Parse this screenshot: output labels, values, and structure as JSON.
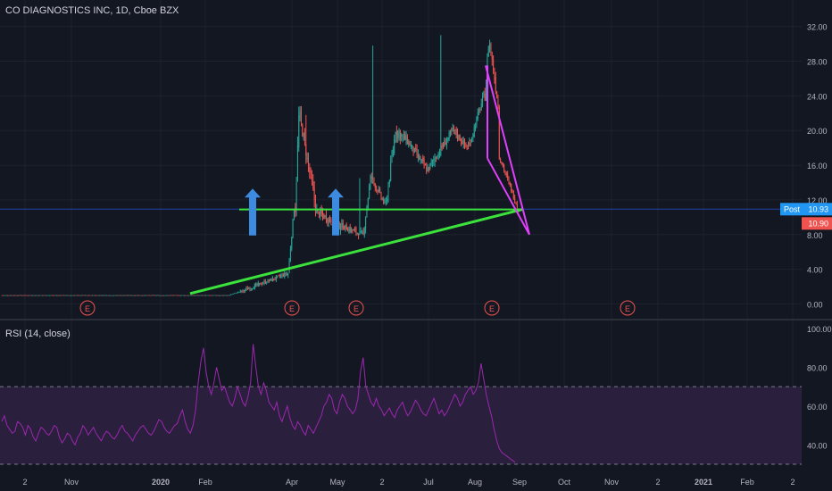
{
  "header": {
    "title": "CO DIAGNOSTICS INC, 1D, Cboe BZX"
  },
  "rsi_header": {
    "title": "RSI (14, close)"
  },
  "colors": {
    "bg": "#131722",
    "grid": "#1e222d",
    "up": "#26a69a",
    "down": "#ef5350",
    "green_line": "#3ce23c",
    "magenta_line": "#e040fb",
    "arrow": "#3d8be0",
    "rsi_line": "#9c27b0",
    "rsi_band": "#2a1f3d",
    "price_line": "#2962ff",
    "post_badge": "#2196f3",
    "close_badge": "#ef5350"
  },
  "chart_data": [
    {
      "type": "candlestick",
      "title": "CO DIAGNOSTICS INC, 1D, Cboe BZX",
      "y_ticks": [
        "0.00",
        "4.00",
        "8.00",
        "12.00",
        "16.00",
        "20.00",
        "24.00",
        "28.00",
        "32.00"
      ],
      "ylim": [
        -1.5,
        33
      ],
      "x_ticks": [
        "2",
        "Nov",
        "2020",
        "Feb",
        "Apr",
        "May",
        "2",
        "Jul",
        "Aug",
        "Sep",
        "Oct",
        "Nov",
        "2",
        "2021",
        "Feb",
        "2"
      ],
      "price_label": {
        "text": "Post",
        "value": "10.93"
      },
      "close_label": {
        "value": "10.90"
      },
      "earnings_markers": [
        "E",
        "E",
        "E",
        "E",
        "E"
      ],
      "annotations": {
        "support_level": 10.9,
        "arrows_up": 2,
        "trendline_from": 1.2,
        "trendline_to": 10.9,
        "wedge_upper_from": 27.5,
        "wedge_lower_from": 16.8,
        "wedge_end": 8.0
      },
      "segments": [
        {
          "from": 1.0,
          "to": 1.0,
          "bars": 190,
          "vol": 0.03
        },
        {
          "from": 1.0,
          "to": 1.4,
          "bars": 10,
          "vol": 0.08
        },
        {
          "from": 1.4,
          "to": 3.5,
          "bars": 40,
          "vol": 0.4
        },
        {
          "from": 3.5,
          "to": 11.0,
          "bars": 6,
          "vol": 0.6
        },
        {
          "from": 11.0,
          "to": 21.5,
          "bars": 4,
          "vol": 1.5
        },
        {
          "from": 21.5,
          "to": 10.5,
          "bars": 15,
          "vol": 1.4
        },
        {
          "from": 10.5,
          "to": 9.0,
          "bars": 20,
          "vol": 0.9
        },
        {
          "from": 9.0,
          "to": 8.0,
          "bars": 18,
          "vol": 0.7
        },
        {
          "from": 8.0,
          "to": 14.5,
          "bars": 7,
          "vol": 0.8
        },
        {
          "from": 14.5,
          "to": 11.5,
          "bars": 12,
          "vol": 0.8
        },
        {
          "from": 11.5,
          "to": 20.0,
          "bars": 9,
          "vol": 1.2
        },
        {
          "from": 20.0,
          "to": 19.0,
          "bars": 8,
          "vol": 1.3
        },
        {
          "from": 19.0,
          "to": 15.5,
          "bars": 18,
          "vol": 0.9
        },
        {
          "from": 15.5,
          "to": 20.0,
          "bars": 22,
          "vol": 0.9
        },
        {
          "from": 20.0,
          "to": 18.0,
          "bars": 12,
          "vol": 0.8
        },
        {
          "from": 18.0,
          "to": 24.0,
          "bars": 14,
          "vol": 1.0
        },
        {
          "from": 24.0,
          "to": 30.0,
          "bars": 4,
          "vol": 1.2
        },
        {
          "from": 30.0,
          "to": 23.0,
          "bars": 8,
          "vol": 1.0
        },
        {
          "from": 17.0,
          "to": 10.9,
          "bars": 17,
          "vol": 0.6
        }
      ],
      "spikes": [
        {
          "bar": 255,
          "high": 21.8
        },
        {
          "bar": 300,
          "high": 14.5
        },
        {
          "bar": 311,
          "high": 29.8
        },
        {
          "bar": 368,
          "high": 31.0
        }
      ]
    },
    {
      "type": "line",
      "title": "RSI (14, close)",
      "y_ticks": [
        "40.00",
        "60.00",
        "80.00",
        "100.00"
      ],
      "ylim": [
        30,
        100
      ],
      "bands": [
        30,
        70
      ],
      "series": [
        {
          "values": [
            52,
            55,
            50,
            48,
            46,
            47,
            52,
            51,
            49,
            45,
            50,
            48,
            44,
            42,
            46,
            49,
            48,
            46,
            45,
            47,
            50,
            49,
            44,
            41,
            43,
            46,
            45,
            42,
            40,
            44,
            46,
            50,
            48,
            45,
            47,
            49,
            46,
            44,
            42,
            45,
            47,
            46,
            44,
            43,
            45,
            48,
            50,
            47,
            46,
            44,
            42,
            45,
            47,
            49,
            50,
            48,
            46,
            45,
            47,
            50,
            53,
            52,
            49,
            47,
            46,
            48,
            50,
            51,
            55,
            58,
            52,
            48,
            46,
            50,
            58,
            72,
            83,
            90,
            78,
            70,
            66,
            72,
            80,
            74,
            68,
            70,
            66,
            62,
            60,
            64,
            70,
            66,
            62,
            60,
            65,
            72,
            92,
            80,
            70,
            66,
            72,
            68,
            62,
            60,
            58,
            62,
            55,
            52,
            56,
            60,
            54,
            50,
            48,
            52,
            50,
            47,
            45,
            50,
            48,
            46,
            49,
            52,
            55,
            60,
            62,
            66,
            64,
            58,
            56,
            62,
            66,
            64,
            60,
            58,
            56,
            58,
            64,
            78,
            85,
            70,
            66,
            62,
            60,
            64,
            60,
            58,
            55,
            57,
            59,
            56,
            54,
            58,
            60,
            62,
            58,
            55,
            57,
            60,
            63,
            61,
            58,
            56,
            55,
            58,
            61,
            64,
            60,
            56,
            58,
            55,
            57,
            60,
            63,
            66,
            64,
            60,
            62,
            66,
            68,
            70,
            66,
            68,
            72,
            82,
            74,
            66,
            60,
            55,
            48,
            42,
            38,
            36,
            35,
            34,
            33,
            32,
            31
          ]
        }
      ]
    }
  ]
}
